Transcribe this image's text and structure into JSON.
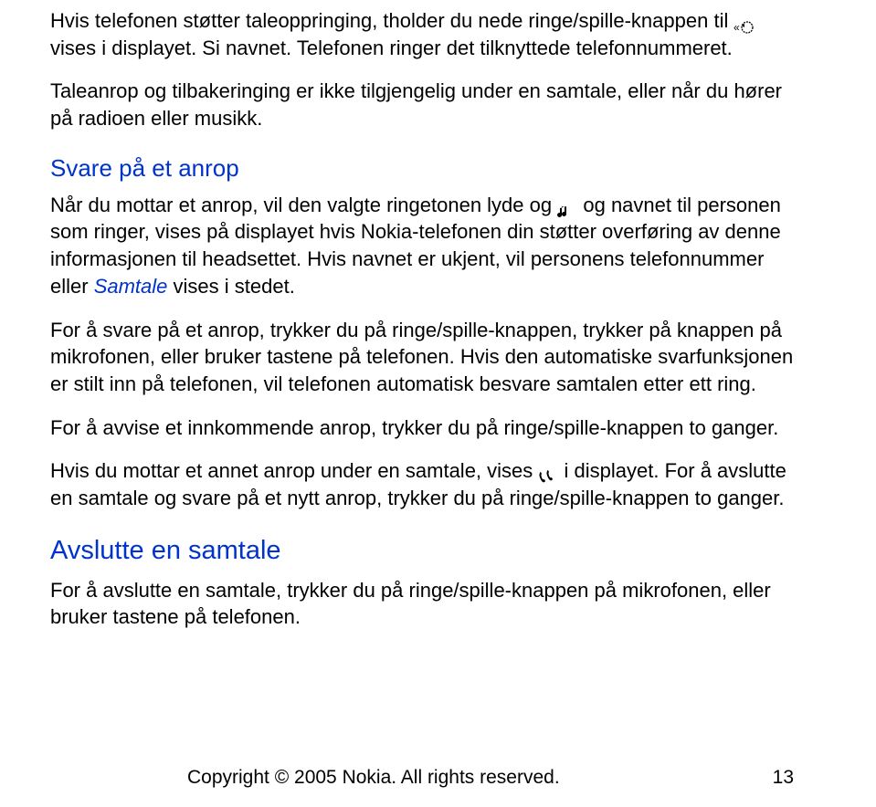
{
  "para1": {
    "part1": "Hvis telefonen støtter taleoppringing, tholder du nede ringe/spille-knappen til ",
    "part2": " vises i displayet. Si navnet. Telefonen ringer det tilknyttede telefonnummeret."
  },
  "para2": "Taleanrop og tilbakeringing er ikke tilgjengelig under en samtale, eller når du hører på radioen eller musikk.",
  "heading1": "Svare på et anrop",
  "para3": {
    "part1": "Når du mottar et anrop, vil den valgte ringetonen lyde og ",
    "part2": " og navnet til personen som ringer, vises på displayet hvis Nokia-telefonen din støtter overføring av denne informasjonen til headsettet. Hvis navnet er ukjent, vil personens telefonnummer eller ",
    "italic": "Samtale",
    "part3": " vises i stedet."
  },
  "para4": "For å svare på et anrop, trykker du på ringe/spille-knappen, trykker på knappen på mikrofonen, eller bruker tastene på telefonen. Hvis den automatiske svarfunksjonen er stilt inn på telefonen, vil telefonen automatisk besvare samtalen etter ett ring.",
  "para5": "For å avvise et innkommende anrop, trykker du på ringe/spille-knappen to ganger.",
  "para6": {
    "part1": "Hvis du mottar et annet anrop under en samtale, vises ",
    "part2": " i displayet. For å avslutte en samtale og svare på et nytt anrop, trykker du på ringe/spille-knappen to ganger."
  },
  "heading2": "Avslutte en samtale",
  "para7": "For å avslutte en samtale, trykker du på ringe/spille-knappen på mikrofonen, eller bruker tastene på telefonen.",
  "footer": {
    "copyright": "Copyright © 2005 Nokia. All rights reserved.",
    "page": "13"
  }
}
